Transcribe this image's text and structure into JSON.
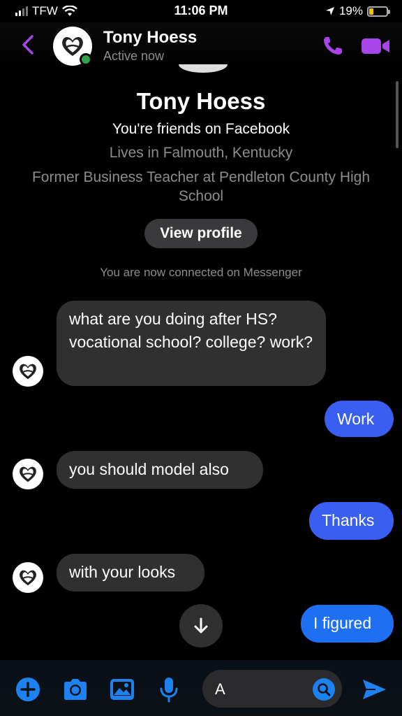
{
  "status_bar": {
    "carrier": "TFW",
    "time": "11:06 PM",
    "battery": "19%",
    "battery_level": 0.19
  },
  "header": {
    "name": "Tony Hoess",
    "status": "Active now",
    "accent": "#a646e8"
  },
  "profile": {
    "name": "Tony Hoess",
    "friends": "You're friends on Facebook",
    "lives": "Lives in Falmouth, Kentucky",
    "work": "Former Business Teacher at Pendleton County High School",
    "view_profile": "View profile",
    "connected": "You are now connected on Messenger"
  },
  "messages": [
    {
      "from": "them",
      "text": "what are you doing after HS? vocational school? college? work?"
    },
    {
      "from": "me",
      "text": "Work"
    },
    {
      "from": "them",
      "text": "you should model also"
    },
    {
      "from": "me",
      "text": "Thanks"
    },
    {
      "from": "them",
      "text": "with your looks"
    },
    {
      "from": "me",
      "text": "I figured"
    }
  ],
  "composer": {
    "value": "A",
    "icons": [
      "plus-icon",
      "camera-icon",
      "image-icon",
      "microphone-icon",
      "emoji-icon",
      "send-icon"
    ],
    "accent": "#1d82f0"
  }
}
